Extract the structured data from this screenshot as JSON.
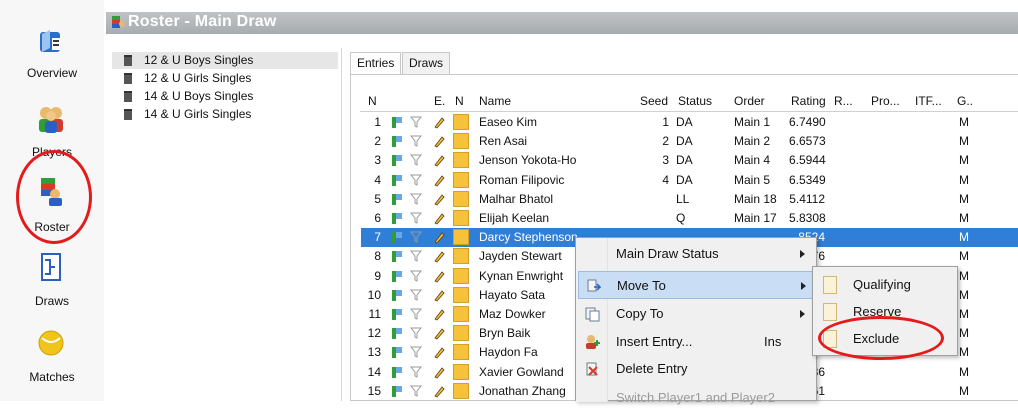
{
  "window": {
    "title": "Roster - Main Draw"
  },
  "nav": {
    "items": [
      {
        "label": "Overview",
        "icon": "overview-icon"
      },
      {
        "label": "Players",
        "icon": "players-icon"
      },
      {
        "label": "Roster",
        "icon": "roster-icon"
      },
      {
        "label": "Draws",
        "icon": "draws-icon"
      },
      {
        "label": "Matches",
        "icon": "matches-icon"
      }
    ]
  },
  "events": [
    "12 & U Boys Singles",
    "12 & U Girls Singles",
    "14 & U Boys Singles",
    "14 & U Girls Singles"
  ],
  "tabs": [
    "Entries",
    "Draws"
  ],
  "table": {
    "headers": {
      "n": "N",
      "e": "E.",
      "n2": "N",
      "name": "Name",
      "seed": "Seed",
      "status": "Status",
      "order": "Order",
      "rating": "Rating",
      "r": "R...",
      "pro": "Pro...",
      "itf": "ITF...",
      "g": "G.."
    },
    "rows": [
      {
        "n": "1",
        "name": "Easeo Kim",
        "seed": "1",
        "status": "DA",
        "order": "Main  1",
        "rating": "6.7490",
        "g": "M"
      },
      {
        "n": "2",
        "name": "Ren Asai",
        "seed": "2",
        "status": "DA",
        "order": "Main  2",
        "rating": "6.6573",
        "g": "M"
      },
      {
        "n": "3",
        "name": "Jenson Yokota-Ho",
        "seed": "3",
        "status": "DA",
        "order": "Main  4",
        "rating": "6.5944",
        "g": "M"
      },
      {
        "n": "4",
        "name": "Roman Filipovic",
        "seed": "4",
        "status": "DA",
        "order": "Main  5",
        "rating": "6.5349",
        "g": "M"
      },
      {
        "n": "5",
        "name": "Malhar Bhatol",
        "seed": "",
        "status": "LL",
        "order": "Main  18",
        "rating": "5.4112",
        "g": "M"
      },
      {
        "n": "6",
        "name": "Elijah Keelan",
        "seed": "",
        "status": "Q",
        "order": "Main  17",
        "rating": "5.8308",
        "g": "M"
      },
      {
        "n": "7",
        "name": "Darcy Stephenson",
        "seed": "",
        "status": "",
        "order": "",
        "rating": ".8524",
        "g": "M"
      },
      {
        "n": "8",
        "name": "Jayden Stewart",
        "seed": "",
        "status": "",
        "order": "",
        "rating": ".8876",
        "g": "M"
      },
      {
        "n": "9",
        "name": "Kynan Enwright",
        "seed": "",
        "status": "",
        "order": "",
        "rating": "",
        "g": "M"
      },
      {
        "n": "10",
        "name": "Hayato Sata",
        "seed": "",
        "status": "",
        "order": "",
        "rating": "",
        "g": "M"
      },
      {
        "n": "11",
        "name": "Maz Dowker",
        "seed": "",
        "status": "",
        "order": "",
        "rating": "",
        "g": "M"
      },
      {
        "n": "12",
        "name": "Bryn Baik",
        "seed": "",
        "status": "",
        "order": "",
        "rating": "",
        "g": "M"
      },
      {
        "n": "13",
        "name": "Haydon Fa",
        "seed": "",
        "status": "",
        "order": "",
        "rating": ".09",
        "g": "M"
      },
      {
        "n": "14",
        "name": "Xavier Gowland",
        "seed": "",
        "status": "",
        "order": "",
        "rating": ".1586",
        "g": "M"
      },
      {
        "n": "15",
        "name": "Jonathan Zhang",
        "seed": "",
        "status": "",
        "order": "",
        "rating": ".3361",
        "g": "M"
      }
    ],
    "selected_row": "7"
  },
  "context_menu": {
    "items": [
      {
        "label": "Main Draw Status",
        "shortcut": "",
        "submenu": true
      },
      {
        "label": "Move To",
        "shortcut": "",
        "submenu": true
      },
      {
        "label": "Copy To",
        "shortcut": "",
        "submenu": true
      },
      {
        "label": "Insert Entry...",
        "shortcut": "Ins",
        "submenu": false
      },
      {
        "label": "Delete Entry",
        "shortcut": "",
        "submenu": false
      },
      {
        "label": "Switch Player1 and Player2",
        "shortcut": "",
        "submenu": false
      }
    ]
  },
  "submenu": {
    "items": [
      "Qualifying",
      "Reserve",
      "Exclude"
    ]
  },
  "colors": {
    "selection": "#2f7fd8",
    "highlight": "#c9def5",
    "annotation": "#e31b1b",
    "title_bar": "#b4b8bb"
  }
}
